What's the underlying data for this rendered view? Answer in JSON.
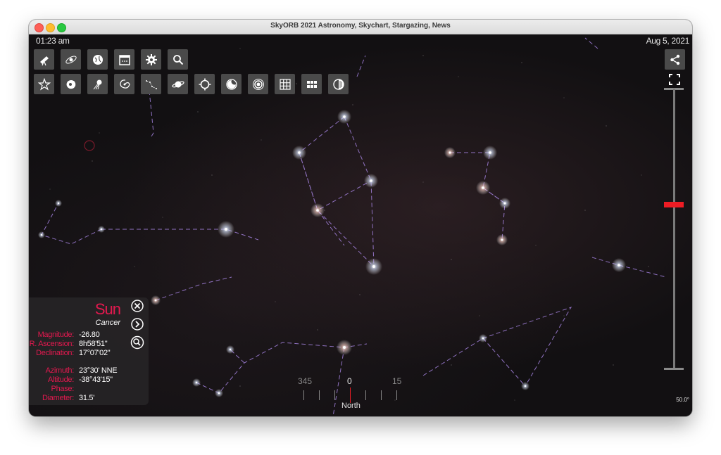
{
  "window": {
    "title": "SkyORB 2021 Astronomy, Skychart, Stargazing, News"
  },
  "status": {
    "time": "01:23 am",
    "date": "Aug 5, 2021"
  },
  "toolbar_row1": [
    {
      "name": "telescope-icon"
    },
    {
      "name": "orbit-icon"
    },
    {
      "name": "globe-icon"
    },
    {
      "name": "calendar-icon"
    },
    {
      "name": "gear-icon"
    },
    {
      "name": "search-icon"
    }
  ],
  "toolbar_row2": [
    {
      "name": "star-icon"
    },
    {
      "name": "nebula-icon"
    },
    {
      "name": "satellite-icon"
    },
    {
      "name": "galaxy-icon"
    },
    {
      "name": "constellation-icon"
    },
    {
      "name": "planet-icon"
    },
    {
      "name": "crosshair-icon"
    },
    {
      "name": "moon-icon"
    },
    {
      "name": "target-icon"
    },
    {
      "name": "grid-icon"
    },
    {
      "name": "grid-dense-icon"
    },
    {
      "name": "contrast-icon"
    }
  ],
  "zoom": {
    "value_label": "50.0°"
  },
  "object_info": {
    "name": "Sun",
    "constellation": "Cancer",
    "magnitude_label": "Magnitude:",
    "magnitude": "-26.80",
    "ra_label": "R. Ascension:",
    "ra": "8h58'51\"",
    "dec_label": "Declination:",
    "dec": "17°07'02\"",
    "azimuth_label": "Azimuth:",
    "azimuth": "23°30' NNE",
    "altitude_label": "Altitude:",
    "altitude": "-38°43'15\"",
    "phase_label": "Phase:",
    "phase": "",
    "diameter_label": "Diameter:",
    "diameter": "31.5'"
  },
  "compass": {
    "left_label": "345",
    "center_label": "0",
    "right_label": "15",
    "direction": "North"
  },
  "colors": {
    "accent_red": "#ee1c24",
    "info_label_pink": "#e3194f",
    "constellation_line": "#9a7ad6"
  }
}
